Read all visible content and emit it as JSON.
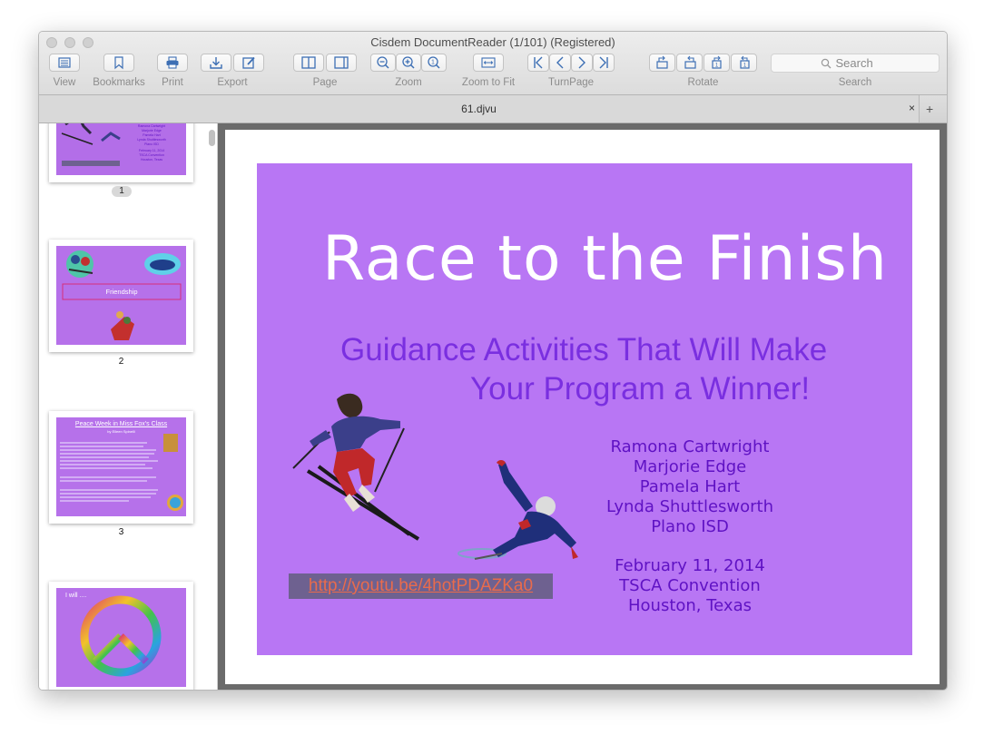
{
  "window": {
    "title": "Cisdem DocumentReader (1/101) (Registered)"
  },
  "toolbar": {
    "view": "View",
    "bookmarks": "Bookmarks",
    "print": "Print",
    "export": "Export",
    "page": "Page",
    "zoom": "Zoom",
    "zoom_to_fit": "Zoom to Fit",
    "turn_page": "TurnPage",
    "rotate": "Rotate",
    "search_label": "Search",
    "search_placeholder": "Search"
  },
  "tabs": [
    {
      "label": "61.djvu"
    }
  ],
  "tab_close": "×",
  "tab_add": "+",
  "thumbnails": [
    {
      "page_label": "1",
      "selected": true,
      "lines": [
        "Ramona Cartwright",
        "Marjorie Edge",
        "Pamela Hart",
        "Lynda Shuttlesworth",
        "Plano ISD",
        "February 11, 2014",
        "TSCA Convention",
        "Houston, Texas"
      ]
    },
    {
      "page_label": "2",
      "box_text": "Friendship"
    },
    {
      "page_label": "3",
      "title": "Peace Week in Miss Fox's Class",
      "byline": "by Eileen Spinelli"
    },
    {
      "page_label": "4",
      "caption": "I will ...."
    }
  ],
  "slide": {
    "title": "Race to the Finish",
    "subtitle_line1": "Guidance Activities That Will Make",
    "subtitle_line2": "Your Program a Winner!",
    "authors": [
      "Ramona Cartwright",
      "Marjorie Edge",
      "Pamela Hart",
      "Lynda Shuttlesworth",
      "Plano ISD"
    ],
    "date": "February 11, 2014",
    "event": "TSCA Convention",
    "location": "Houston, Texas",
    "link": "http://youtu.be/4hotPDAZKa0"
  },
  "colors": {
    "slide_bg": "#b876f4",
    "subtitle": "#7a2fe0",
    "names": "#5f12c4",
    "link_text": "#e96b4c",
    "link_bg": "#6e6190",
    "viewer_bg": "#6b6b6b",
    "toolbar_icon": "#3d6fb4"
  }
}
